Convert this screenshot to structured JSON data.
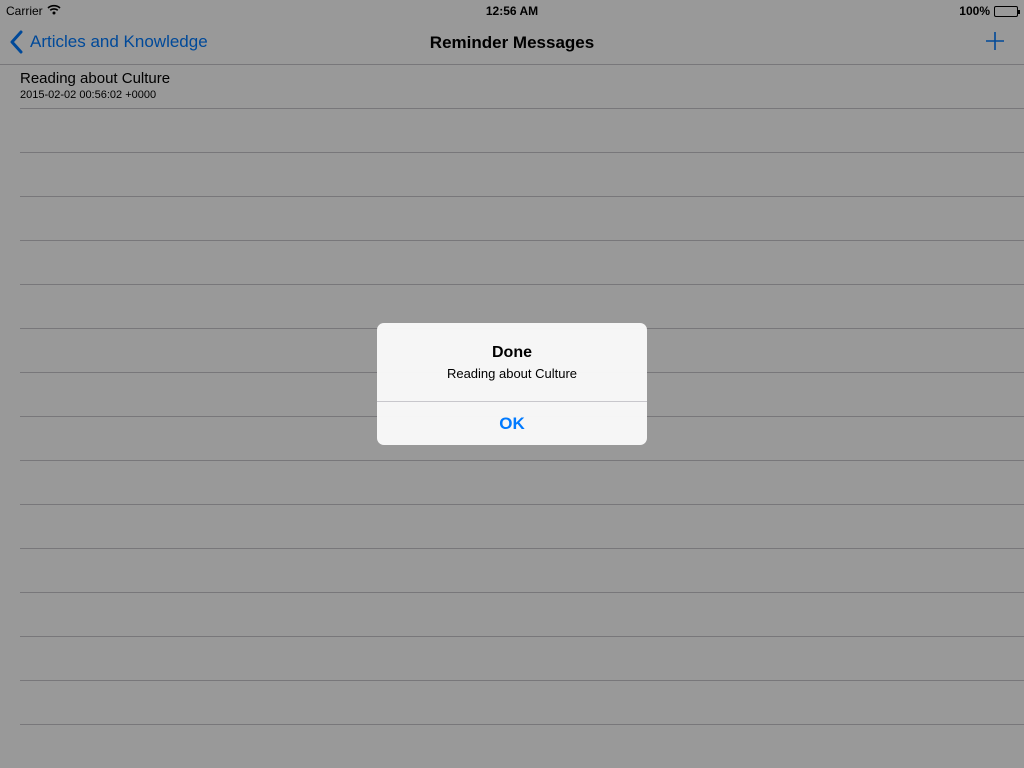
{
  "status_bar": {
    "carrier": "Carrier",
    "time": "12:56 AM",
    "battery": "100%",
    "battery_level": 1.0
  },
  "nav": {
    "back_label": "Articles and Knowledge",
    "title": "Reminder Messages",
    "add_icon": "plus-icon",
    "accent_color": "#007aff"
  },
  "table": {
    "rows": [
      {
        "title": "Reading about Culture",
        "subtitle": "2015-02-02 00:56:02 +0000"
      }
    ]
  },
  "alert": {
    "title": "Done",
    "message": "Reading about Culture",
    "button_label": "OK"
  }
}
